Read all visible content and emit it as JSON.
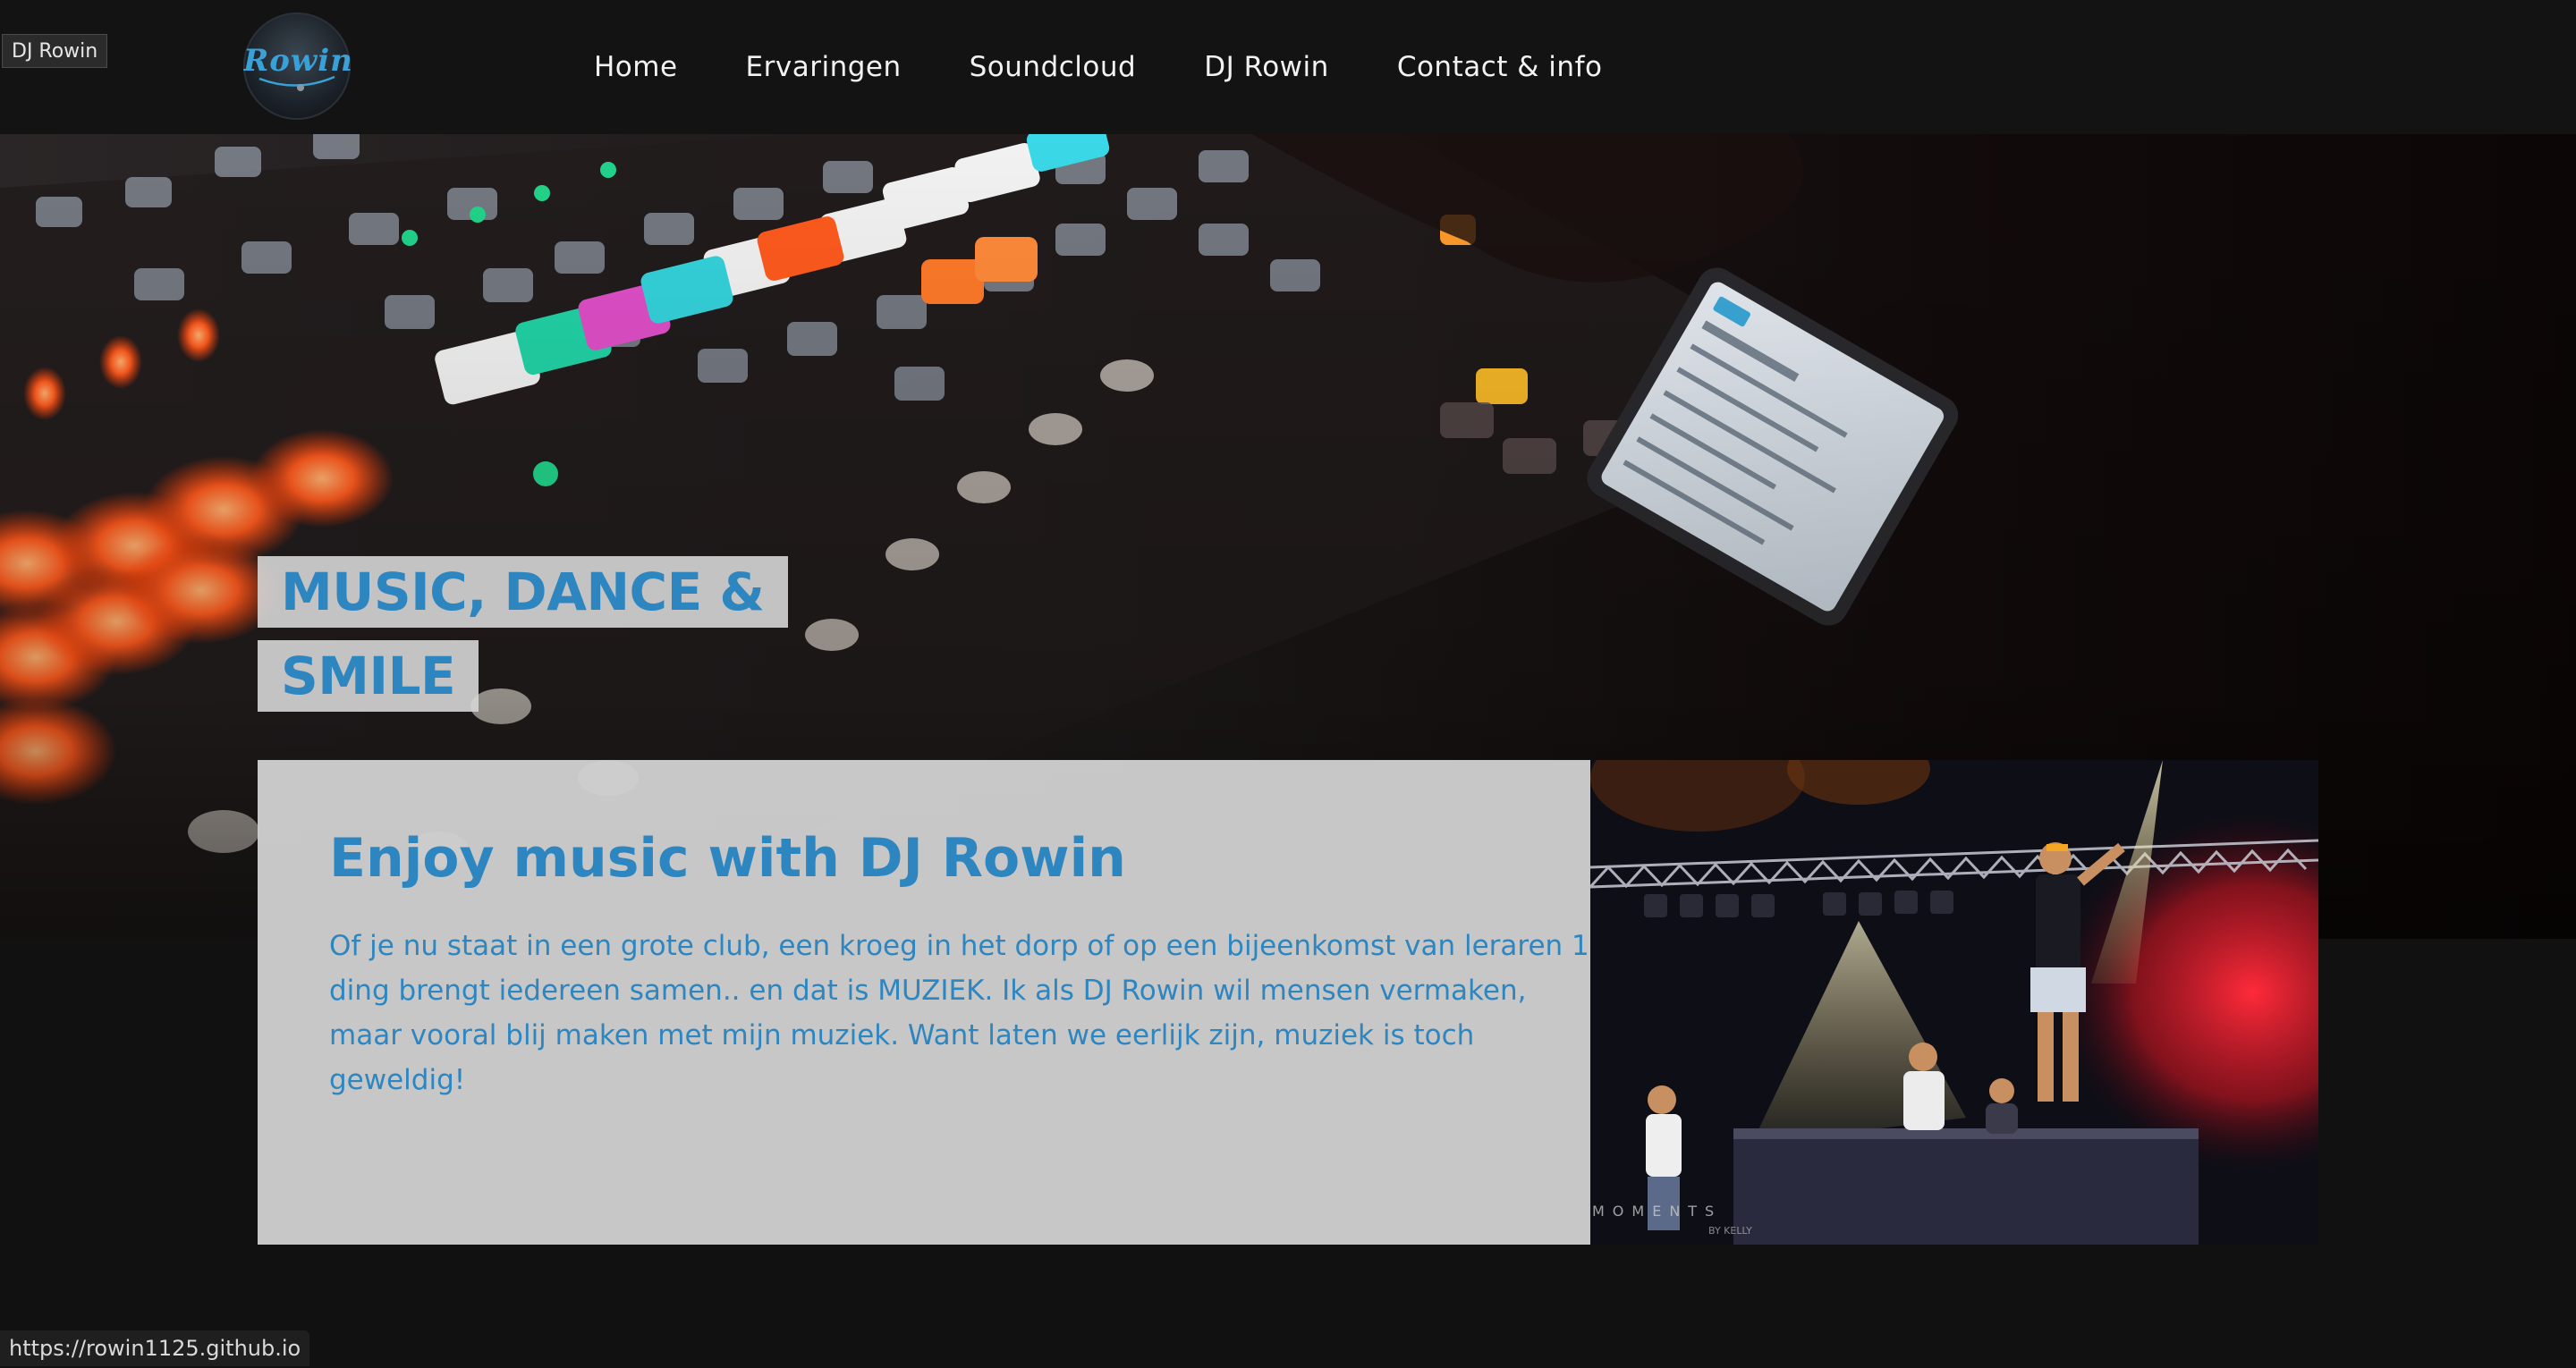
{
  "tooltip": {
    "label": "DJ Rowin"
  },
  "header": {
    "logo_text": "Rowin",
    "nav": [
      "Home",
      "Ervaringen",
      "Soundcloud",
      "DJ Rowin",
      "Contact & info"
    ]
  },
  "hero": {
    "title_line1": "MUSIC, DANCE &",
    "title_line2": "SMILE"
  },
  "intro": {
    "heading": "Enjoy music with DJ Rowin",
    "body": "Of je nu staat in een grote club, een kroeg in het dorp of op een bijeenkomst van leraren 1 ding brengt iedereen samen.. en dat is MUZIEK. Ik als DJ Rowin wil mensen vermaken, maar vooral blij maken met mijn muziek. Want laten we eerlijk zijn, muziek is toch geweldig!"
  },
  "photo": {
    "watermark": "MOMENTS",
    "watermark_sub": "BY KELLY"
  },
  "status_bar": {
    "url": "https://rowin1125.github.io"
  },
  "colors": {
    "accent": "#2e86c1",
    "background": "#111111",
    "card": "#d2d2d2"
  },
  "icons": {
    "logo": "rowin-logo-icon"
  }
}
